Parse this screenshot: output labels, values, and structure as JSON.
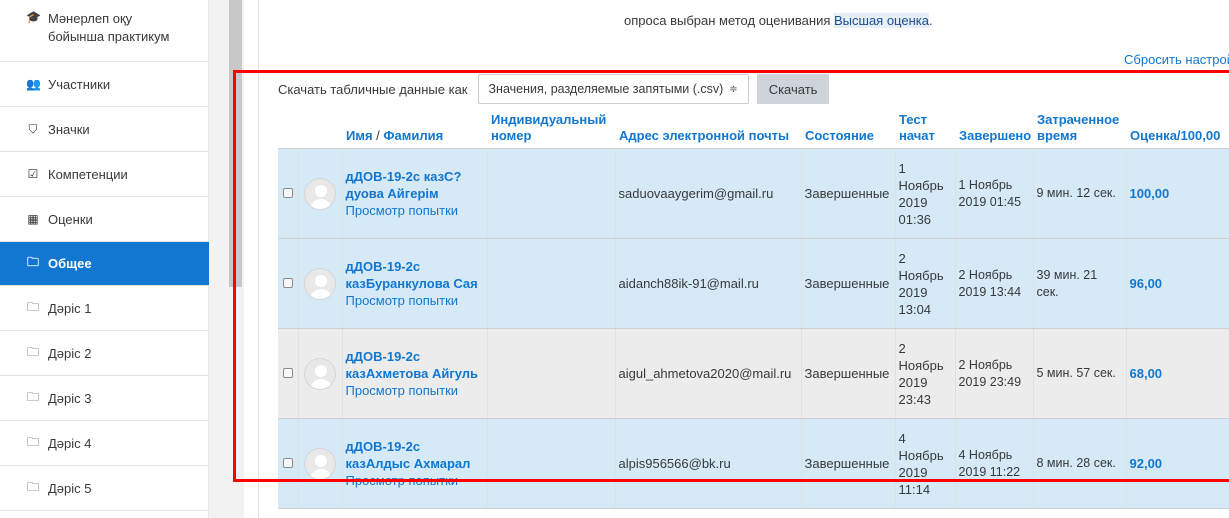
{
  "sidebar": {
    "items": [
      {
        "icon": "graduation-cap-icon",
        "glyph": "🎓",
        "label": "Мәнерлеп оқу бойынша практикум"
      },
      {
        "icon": "users-icon",
        "glyph": "👥",
        "label": "Участники"
      },
      {
        "icon": "shield-icon",
        "glyph": "⛉",
        "label": "Значки"
      },
      {
        "icon": "checkbox-icon",
        "glyph": "☑",
        "label": "Компетенции"
      },
      {
        "icon": "table-icon",
        "glyph": "▦",
        "label": "Оценки"
      },
      {
        "icon": "folder-icon",
        "glyph": "🗀",
        "label": "Общее"
      },
      {
        "icon": "folder-icon",
        "glyph": "🗀",
        "label": "Дәріс 1"
      },
      {
        "icon": "folder-icon",
        "glyph": "🗀",
        "label": "Дәріс 2"
      },
      {
        "icon": "folder-icon",
        "glyph": "🗀",
        "label": "Дәріс 3"
      },
      {
        "icon": "folder-icon",
        "glyph": "🗀",
        "label": "Дәріс 4"
      },
      {
        "icon": "folder-icon",
        "glyph": "🗀",
        "label": "Дәріс 5"
      }
    ],
    "active_index": 5
  },
  "notice": {
    "text": "опроса выбран метод оценивания ",
    "highlight": "Высшая оценка",
    "end": "."
  },
  "reset_link": "Сбросить настрой",
  "download": {
    "label": "Скачать табличные данные как",
    "format": "Значения, разделяемые запятыми (.csv)",
    "caret": "≑",
    "button": "Скачать"
  },
  "table": {
    "headers": {
      "name_first": "Имя",
      "name_sep": " / ",
      "name_last": "Фамилия",
      "id_number": "Индивидуальный номер",
      "email": "Адрес электронной почты",
      "state": "Состояние",
      "started": "Тест начат",
      "completed": "Завершено",
      "duration": "Затраченное время",
      "grade": "Оценка/100,00"
    },
    "rows": [
      {
        "name": "дДОВ-19-2с казС?дуова Айгерім",
        "review": "Просмотр попытки",
        "id_number": "",
        "email": "saduovaaygerim@gmail.ru",
        "state": "Завершенные",
        "started": "1 Ноябрь 2019 01:36",
        "completed": "1 Ноябрь 2019 01:45",
        "duration": "9 мин. 12 сек.",
        "grade": "100,00",
        "tone": "blue"
      },
      {
        "name": "дДОВ-19-2с казБуранкулова Сая",
        "review": "Просмотр попытки",
        "id_number": "",
        "email": "aidanch88ik-91@mail.ru",
        "state": "Завершенные",
        "started": "2 Ноябрь 2019 13:04",
        "completed": "2 Ноябрь 2019 13:44",
        "duration": "39 мин. 21 сек.",
        "grade": "96,00",
        "tone": "blue"
      },
      {
        "name": "дДОВ-19-2с казАхметова Айгуль",
        "review": "Просмотр попытки",
        "id_number": "",
        "email": "aigul_ahmetova2020@mail.ru",
        "state": "Завершенные",
        "started": "2 Ноябрь 2019 23:43",
        "completed": "2 Ноябрь 2019 23:49",
        "duration": "5 мин. 57 сек.",
        "grade": "68,00",
        "tone": "grey"
      },
      {
        "name": "дДОВ-19-2с казАлдыс Ахмарал",
        "review": "Просмотр попытки",
        "id_number": "",
        "email": "alpis956566@bk.ru",
        "state": "Завершенные",
        "started": "4 Ноябрь 2019 11:14",
        "completed": "4 Ноябрь 2019 11:22",
        "duration": "8 мин. 28 сек.",
        "grade": "92,00",
        "tone": "blue"
      }
    ]
  },
  "colors": {
    "accent": "#1177d1",
    "row_blue": "#d6e9f7",
    "row_grey": "#ececec",
    "highlight_frame": "#ff0000"
  }
}
